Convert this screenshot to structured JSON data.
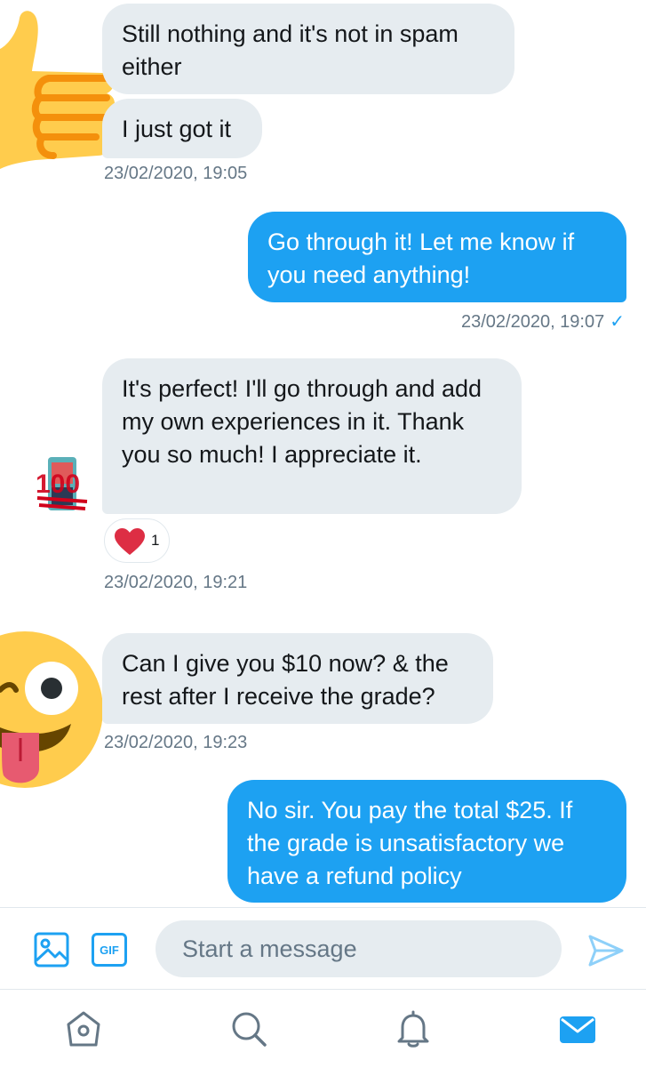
{
  "messages": [
    {
      "text": "Still nothing and it's not in spam either"
    },
    {
      "text": "I just got it"
    },
    {
      "timestamp": "23/02/2020, 19:05"
    },
    {
      "text": "Go through it! Let me know if you need anything!"
    },
    {
      "timestamp": "23/02/2020, 19:07"
    },
    {
      "text": "It's perfect! I'll go through  and add my own experiences in it. Thank you so much! I appreciate it."
    },
    {
      "reaction_count": "1"
    },
    {
      "timestamp": "23/02/2020, 19:21"
    },
    {
      "text": "Can I give you $10 now? & the rest after I receive the grade?"
    },
    {
      "timestamp": "23/02/2020, 19:23"
    },
    {
      "text": "No sir. You pay the total $25. If the grade is unsatisfactory we have a refund policy"
    }
  ],
  "compose": {
    "placeholder": "Start a message",
    "gif_label": "GIF"
  },
  "tabbar": {
    "items": [
      "home-icon",
      "search-icon",
      "notifications-icon",
      "messages-icon"
    ],
    "active": "messages-icon"
  },
  "colors": {
    "accent": "#1da1f2",
    "incoming_bubble": "#e6ecf0",
    "timestamp": "#657786",
    "heart": "#e0245e"
  }
}
